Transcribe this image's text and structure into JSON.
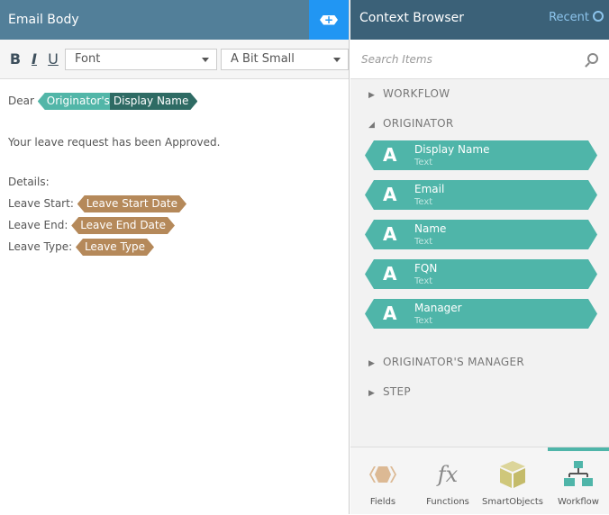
{
  "editor": {
    "title": "Email Body",
    "add_icon": "+",
    "toolbar": {
      "bold": "B",
      "italic": "I",
      "underline": "U",
      "font": "Font",
      "size": "A Bit Small"
    },
    "body": {
      "dear": "Dear",
      "chip_prefix": "Originator's",
      "chip_name": "Display Name",
      "line1": "Your leave request has been Approved.",
      "details": "Details:",
      "rows": [
        {
          "label": "Leave Start:",
          "chip": "Leave Start Date"
        },
        {
          "label": "Leave End:",
          "chip": "Leave End Date"
        },
        {
          "label": "Leave Type:",
          "chip": "Leave Type"
        }
      ]
    }
  },
  "browser": {
    "title": "Context Browser",
    "recent": "Recent",
    "search_placeholder": "Search Items",
    "sections": {
      "workflow": "WORKFLOW",
      "originator": "ORIGINATOR",
      "manager": "ORIGINATOR'S MANAGER",
      "step": "STEP"
    },
    "items": [
      {
        "icon": "A",
        "name": "Display Name",
        "type": "Text"
      },
      {
        "icon": "A",
        "name": "Email",
        "type": "Text"
      },
      {
        "icon": "A",
        "name": "Name",
        "type": "Text"
      },
      {
        "icon": "A",
        "name": "FQN",
        "type": "Text"
      },
      {
        "icon": "A",
        "name": "Manager",
        "type": "Text"
      }
    ],
    "tabs": [
      "Fields",
      "Functions",
      "SmartObjects",
      "Workflow"
    ],
    "fx": "fx"
  }
}
